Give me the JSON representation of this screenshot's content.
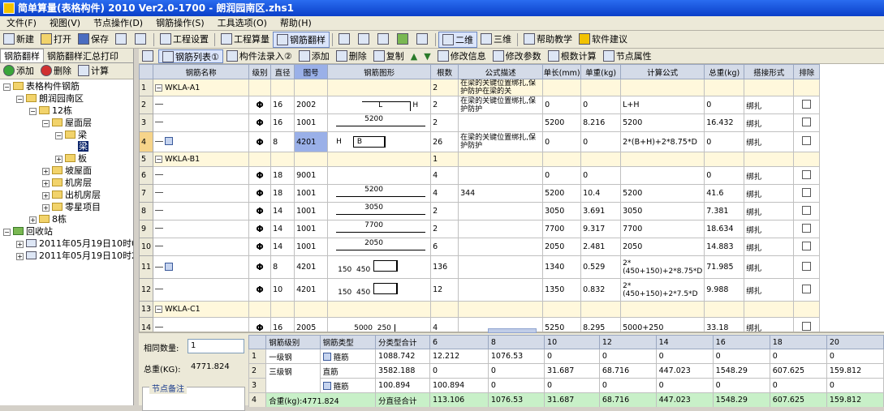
{
  "title": "简单算量(表格构件) 2010 Ver2.0-1700 - 朗润园南区.zhs1",
  "menu": [
    "文件(F)",
    "视图(V)",
    "节点操作(D)",
    "钢筋操作(S)",
    "工具选项(O)",
    "帮助(H)"
  ],
  "toolbar": {
    "new": "新建",
    "open": "打开",
    "save": "保存",
    "project_settings": "工程设置",
    "project_calc": "工程算量",
    "rebar_translate": "钢筋翻样",
    "view2d": "二维",
    "view3d": "三维",
    "help_teach": "帮助教学",
    "suggest": "软件建议"
  },
  "left": {
    "tabs": [
      "钢筋翻样",
      "钢筋翻样汇总打印"
    ],
    "add": "添加",
    "delete": "删除",
    "calc": "计算",
    "tree": {
      "root": "表格构件钢筋",
      "project": "朗润园南区",
      "building": "12栋",
      "roof": "屋面层",
      "beam": "梁",
      "beam_sel": "梁",
      "slab": "板",
      "slope_roof": "坡屋面",
      "machine": "机房层",
      "out_machine": "出机房层",
      "misc": "零星项目",
      "b8": "8栋",
      "recycle": "回收站",
      "r1": "2011年05月19日10时09分",
      "r2": "2011年05月19日10时26分"
    }
  },
  "righttool": {
    "list": "钢筋列表①",
    "method": "构件法录入②",
    "add": "添加",
    "delete": "删除",
    "copy": "复制",
    "modify_info": "修改信息",
    "modify_param": "修改参数",
    "root_calc": "根数计算",
    "node_attr": "节点属性"
  },
  "grid": {
    "headers": [
      "钢筋名称",
      "级别",
      "直径",
      "图号",
      "钢筋图形",
      "根数",
      "公式描述",
      "单长(mm)",
      "单重(kg)",
      "计算公式",
      "总重(kg)",
      "搭接形式",
      "排除"
    ],
    "rows": [
      {
        "n": "1",
        "name": "WKLA-A1",
        "grade": "",
        "dia": "",
        "fig": "",
        "shape": "",
        "count": "2",
        "desc": "在梁的关键位置绑扎,保护防护在梁的关",
        "len": "",
        "wt": "",
        "formula": "",
        "total": "",
        "lap": ""
      },
      {
        "n": "2",
        "name": "",
        "grade": "Φ",
        "dia": "16",
        "fig": "2002",
        "shape": "L    H",
        "count": "2",
        "desc": "在梁的关键位置绑扎,保护防护",
        "len": "0",
        "wt": "0",
        "formula": "L+H",
        "total": "0",
        "lap": "绑扎"
      },
      {
        "n": "3",
        "name": "",
        "grade": "Φ",
        "dia": "16",
        "fig": "1001",
        "shape": "5200",
        "count": "2",
        "desc": "",
        "len": "5200",
        "wt": "8.216",
        "formula": "5200",
        "total": "16.432",
        "lap": "绑扎"
      },
      {
        "n": "4",
        "name": "",
        "grade": "Φ",
        "dia": "8",
        "fig": "4201",
        "shape": "H    B",
        "count": "26",
        "desc": "在梁的关键位置绑扎,保护防护",
        "len": "0",
        "wt": "0",
        "formula": "2*(B+H)+2*8.75*D",
        "total": "0",
        "lap": "绑扎"
      },
      {
        "n": "5",
        "name": "WKLA-B1",
        "grade": "",
        "dia": "",
        "fig": "",
        "shape": "",
        "count": "1",
        "desc": "",
        "len": "",
        "wt": "",
        "formula": "",
        "total": "",
        "lap": ""
      },
      {
        "n": "6",
        "name": "",
        "grade": "Φ",
        "dia": "18",
        "fig": "9001",
        "shape": "",
        "count": "4",
        "desc": "",
        "len": "0",
        "wt": "0",
        "formula": "",
        "total": "0",
        "lap": "绑扎"
      },
      {
        "n": "7",
        "name": "",
        "grade": "Φ",
        "dia": "18",
        "fig": "1001",
        "shape": "5200",
        "count": "4",
        "desc": "344",
        "len": "5200",
        "wt": "10.4",
        "formula": "5200",
        "total": "41.6",
        "lap": "绑扎"
      },
      {
        "n": "8",
        "name": "",
        "grade": "Φ",
        "dia": "14",
        "fig": "1001",
        "shape": "3050",
        "count": "2",
        "desc": "",
        "len": "3050",
        "wt": "3.691",
        "formula": "3050",
        "total": "7.381",
        "lap": "绑扎"
      },
      {
        "n": "9",
        "name": "",
        "grade": "Φ",
        "dia": "14",
        "fig": "1001",
        "shape": "7700",
        "count": "2",
        "desc": "",
        "len": "7700",
        "wt": "9.317",
        "formula": "7700",
        "total": "18.634",
        "lap": "绑扎"
      },
      {
        "n": "10",
        "name": "",
        "grade": "Φ",
        "dia": "14",
        "fig": "1001",
        "shape": "2050",
        "count": "6",
        "desc": "",
        "len": "2050",
        "wt": "2.481",
        "formula": "2050",
        "total": "14.883",
        "lap": "绑扎"
      },
      {
        "n": "11",
        "name": "",
        "grade": "Φ",
        "dia": "8",
        "fig": "4201",
        "shape": "150  450",
        "count": "136",
        "desc": "",
        "len": "1340",
        "wt": "0.529",
        "formula": "2*(450+150)+2*8.75*D",
        "total": "71.985",
        "lap": "绑扎"
      },
      {
        "n": "12",
        "name": "",
        "grade": "Φ",
        "dia": "10",
        "fig": "4201",
        "shape": "150  450",
        "count": "12",
        "desc": "",
        "len": "1350",
        "wt": "0.832",
        "formula": "2*(450+150)+2*7.5*D",
        "total": "9.988",
        "lap": "绑扎"
      },
      {
        "n": "13",
        "name": "WKLA-C1",
        "grade": "",
        "dia": "",
        "fig": "",
        "shape": "",
        "count": "",
        "desc": "",
        "len": "",
        "wt": "",
        "formula": "",
        "total": "",
        "lap": ""
      },
      {
        "n": "14",
        "name": "",
        "grade": "Φ",
        "dia": "16",
        "fig": "2005",
        "shape": "5000  250",
        "count": "4",
        "desc": "",
        "len": "5250",
        "wt": "8.295",
        "formula": "5000+250",
        "total": "33.18",
        "lap": "绑扎"
      }
    ]
  },
  "bottom": {
    "same_qty_label": "相同数量:",
    "same_qty": "1",
    "total_label": "总重(KG):",
    "total": "4771.824",
    "note_label": "节点备注",
    "headers": [
      "钢筋级别",
      "钢筋类型",
      "分类型合计",
      "6",
      "8",
      "10",
      "12",
      "14",
      "16",
      "18",
      "20"
    ],
    "rows": [
      {
        "n": "1",
        "grade": "一级钢",
        "type": "箍筋",
        "sum": "1088.742",
        "c6": "12.212",
        "c8": "1076.53",
        "c10": "0",
        "c12": "0",
        "c14": "0",
        "c16": "0",
        "c18": "0",
        "c20": "0"
      },
      {
        "n": "2",
        "grade": "三级钢",
        "type": "直筋",
        "sum": "3582.188",
        "c6": "0",
        "c8": "0",
        "c10": "31.687",
        "c12": "68.716",
        "c14": "447.023",
        "c16": "1548.29",
        "c18": "607.625",
        "c20": "159.812"
      },
      {
        "n": "3",
        "grade": "",
        "type": "箍筋",
        "sum": "100.894",
        "c6": "100.894",
        "c8": "0",
        "c10": "0",
        "c12": "0",
        "c14": "0",
        "c16": "0",
        "c18": "0",
        "c20": "0"
      },
      {
        "n": "4",
        "grade": "合重(kg):4771.824",
        "type": "",
        "sum": "分直径合计",
        "c6": "113.106",
        "c8": "1076.53",
        "c10": "31.687",
        "c12": "68.716",
        "c14": "447.023",
        "c16": "1548.29",
        "c18": "607.625",
        "c20": "159.812"
      }
    ]
  },
  "colors": {
    "title": "#0a3fc8",
    "selected_fig": "#9ab0e8",
    "group_row": "#fff8dc",
    "sum_row": "#c8f0c8"
  }
}
